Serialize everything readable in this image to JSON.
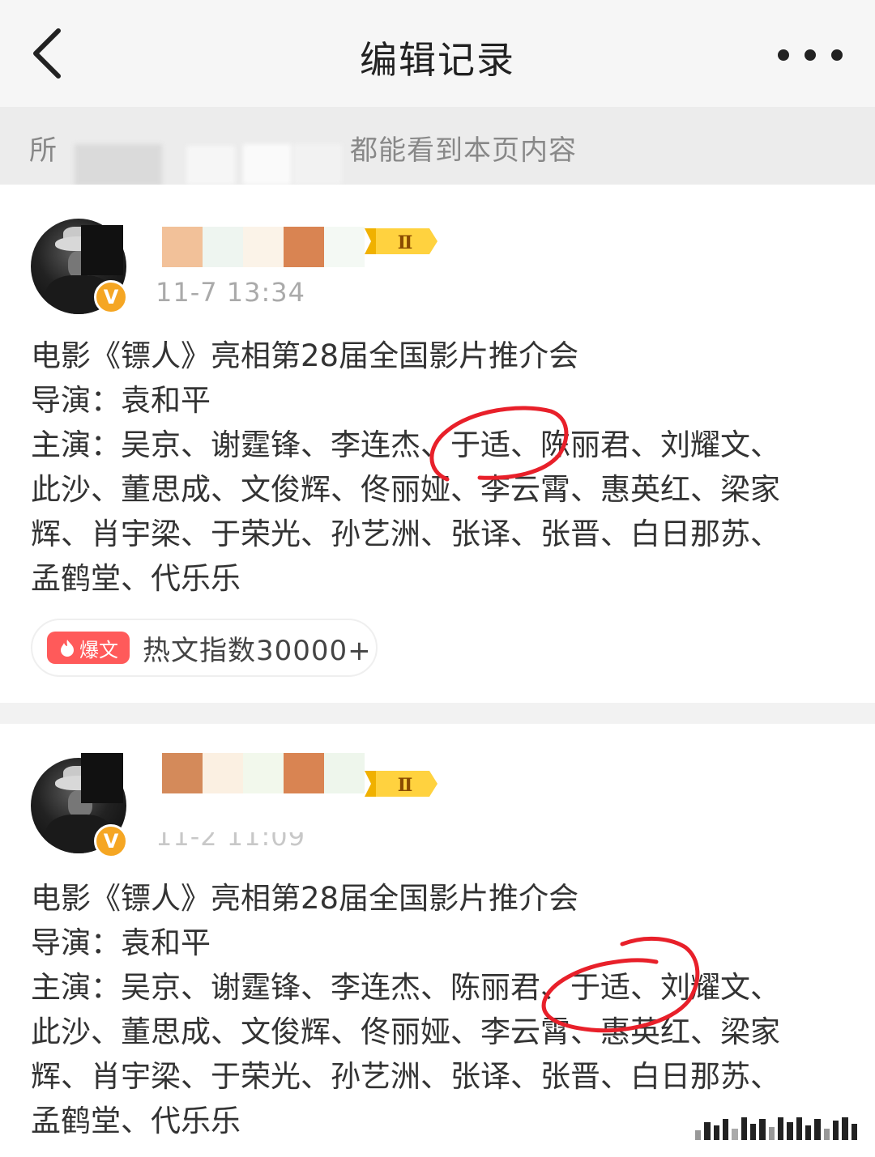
{
  "header": {
    "title": "编辑记录",
    "back_icon": "chevron-left-icon",
    "more_icon": "more-dots-icon"
  },
  "notice": {
    "prefix": "所",
    "suffix": "都能看到本页内容"
  },
  "posts": [
    {
      "timestamp": "11-7 13:34",
      "level_badge": "Ⅱ",
      "verified_badge": "V",
      "lines": [
        "电影《镖人》亮相第28届全国影片推介会",
        "导演：袁和平",
        "主演：吴京、谢霆锋、李连杰、于适、陈丽君、刘耀文、",
        "此沙、董思成、文俊辉、佟丽娅、李云霄、惠英红、梁家",
        "辉、肖宇梁、于荣光、孙艺洲、张译、张晋、白日那苏、",
        "孟鹤堂、代乐乐"
      ],
      "hot_tag": "爆文",
      "hot_index": "热文指数30000+"
    },
    {
      "timestamp": "11-2 11:09",
      "level_badge": "Ⅱ",
      "verified_badge": "V",
      "lines": [
        "电影《镖人》亮相第28届全国影片推介会",
        "导演：袁和平",
        "主演：吴京、谢霆锋、李连杰、陈丽君、于适、刘耀文、",
        "此沙、董思成、文俊辉、佟丽娅、李云霄、惠英红、梁家",
        "辉、肖宇梁、于荣光、孙艺洲、张译、张晋、白日那苏、",
        "孟鹤堂、代乐乐"
      ]
    }
  ],
  "colors": {
    "annotation_red": "#e8202a",
    "hot_tag_red": "#ff5a5a",
    "verified_orange": "#f5a623",
    "header_bg": "#f6f6f6",
    "notice_bg": "#ececec"
  }
}
